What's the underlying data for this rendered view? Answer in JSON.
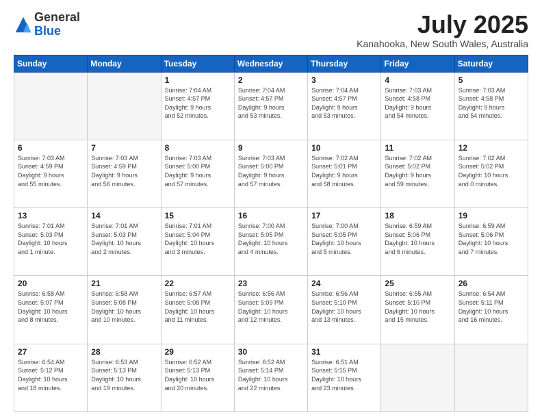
{
  "header": {
    "logo_general": "General",
    "logo_blue": "Blue",
    "month_title": "July 2025",
    "location": "Kanahooka, New South Wales, Australia"
  },
  "calendar": {
    "days_of_week": [
      "Sunday",
      "Monday",
      "Tuesday",
      "Wednesday",
      "Thursday",
      "Friday",
      "Saturday"
    ],
    "weeks": [
      [
        {
          "day": "",
          "info": ""
        },
        {
          "day": "",
          "info": ""
        },
        {
          "day": "1",
          "info": "Sunrise: 7:04 AM\nSunset: 4:57 PM\nDaylight: 9 hours\nand 52 minutes."
        },
        {
          "day": "2",
          "info": "Sunrise: 7:04 AM\nSunset: 4:57 PM\nDaylight: 9 hours\nand 53 minutes."
        },
        {
          "day": "3",
          "info": "Sunrise: 7:04 AM\nSunset: 4:57 PM\nDaylight: 9 hours\nand 53 minutes."
        },
        {
          "day": "4",
          "info": "Sunrise: 7:03 AM\nSunset: 4:58 PM\nDaylight: 9 hours\nand 54 minutes."
        },
        {
          "day": "5",
          "info": "Sunrise: 7:03 AM\nSunset: 4:58 PM\nDaylight: 9 hours\nand 54 minutes."
        }
      ],
      [
        {
          "day": "6",
          "info": "Sunrise: 7:03 AM\nSunset: 4:59 PM\nDaylight: 9 hours\nand 55 minutes."
        },
        {
          "day": "7",
          "info": "Sunrise: 7:03 AM\nSunset: 4:59 PM\nDaylight: 9 hours\nand 56 minutes."
        },
        {
          "day": "8",
          "info": "Sunrise: 7:03 AM\nSunset: 5:00 PM\nDaylight: 9 hours\nand 57 minutes."
        },
        {
          "day": "9",
          "info": "Sunrise: 7:03 AM\nSunset: 5:00 PM\nDaylight: 9 hours\nand 57 minutes."
        },
        {
          "day": "10",
          "info": "Sunrise: 7:02 AM\nSunset: 5:01 PM\nDaylight: 9 hours\nand 58 minutes."
        },
        {
          "day": "11",
          "info": "Sunrise: 7:02 AM\nSunset: 5:02 PM\nDaylight: 9 hours\nand 59 minutes."
        },
        {
          "day": "12",
          "info": "Sunrise: 7:02 AM\nSunset: 5:02 PM\nDaylight: 10 hours\nand 0 minutes."
        }
      ],
      [
        {
          "day": "13",
          "info": "Sunrise: 7:01 AM\nSunset: 5:03 PM\nDaylight: 10 hours\nand 1 minute."
        },
        {
          "day": "14",
          "info": "Sunrise: 7:01 AM\nSunset: 5:03 PM\nDaylight: 10 hours\nand 2 minutes."
        },
        {
          "day": "15",
          "info": "Sunrise: 7:01 AM\nSunset: 5:04 PM\nDaylight: 10 hours\nand 3 minutes."
        },
        {
          "day": "16",
          "info": "Sunrise: 7:00 AM\nSunset: 5:05 PM\nDaylight: 10 hours\nand 4 minutes."
        },
        {
          "day": "17",
          "info": "Sunrise: 7:00 AM\nSunset: 5:05 PM\nDaylight: 10 hours\nand 5 minutes."
        },
        {
          "day": "18",
          "info": "Sunrise: 6:59 AM\nSunset: 5:06 PM\nDaylight: 10 hours\nand 6 minutes."
        },
        {
          "day": "19",
          "info": "Sunrise: 6:59 AM\nSunset: 5:06 PM\nDaylight: 10 hours\nand 7 minutes."
        }
      ],
      [
        {
          "day": "20",
          "info": "Sunrise: 6:58 AM\nSunset: 5:07 PM\nDaylight: 10 hours\nand 8 minutes."
        },
        {
          "day": "21",
          "info": "Sunrise: 6:58 AM\nSunset: 5:08 PM\nDaylight: 10 hours\nand 10 minutes."
        },
        {
          "day": "22",
          "info": "Sunrise: 6:57 AM\nSunset: 5:08 PM\nDaylight: 10 hours\nand 11 minutes."
        },
        {
          "day": "23",
          "info": "Sunrise: 6:56 AM\nSunset: 5:09 PM\nDaylight: 10 hours\nand 12 minutes."
        },
        {
          "day": "24",
          "info": "Sunrise: 6:56 AM\nSunset: 5:10 PM\nDaylight: 10 hours\nand 13 minutes."
        },
        {
          "day": "25",
          "info": "Sunrise: 6:55 AM\nSunset: 5:10 PM\nDaylight: 10 hours\nand 15 minutes."
        },
        {
          "day": "26",
          "info": "Sunrise: 6:54 AM\nSunset: 5:11 PM\nDaylight: 10 hours\nand 16 minutes."
        }
      ],
      [
        {
          "day": "27",
          "info": "Sunrise: 6:54 AM\nSunset: 5:12 PM\nDaylight: 10 hours\nand 18 minutes."
        },
        {
          "day": "28",
          "info": "Sunrise: 6:53 AM\nSunset: 5:13 PM\nDaylight: 10 hours\nand 19 minutes."
        },
        {
          "day": "29",
          "info": "Sunrise: 6:52 AM\nSunset: 5:13 PM\nDaylight: 10 hours\nand 20 minutes."
        },
        {
          "day": "30",
          "info": "Sunrise: 6:52 AM\nSunset: 5:14 PM\nDaylight: 10 hours\nand 22 minutes."
        },
        {
          "day": "31",
          "info": "Sunrise: 6:51 AM\nSunset: 5:15 PM\nDaylight: 10 hours\nand 23 minutes."
        },
        {
          "day": "",
          "info": ""
        },
        {
          "day": "",
          "info": ""
        }
      ]
    ]
  }
}
